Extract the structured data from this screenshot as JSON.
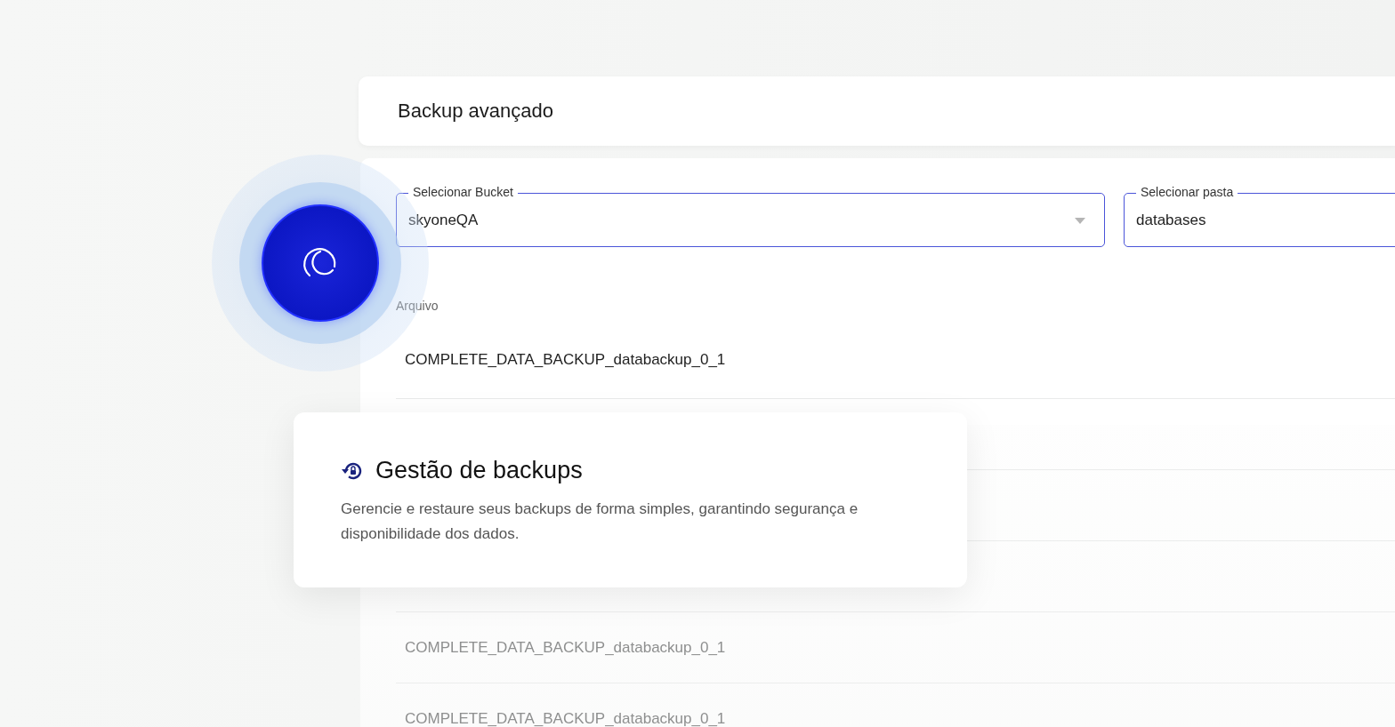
{
  "header": {
    "title": "Backup avançado"
  },
  "fields": [
    {
      "label": "Selecionar Bucket",
      "value": "skyoneQA",
      "kind": "dropdown"
    },
    {
      "label": "Selecionar pasta",
      "value": "databases",
      "kind": "text"
    }
  ],
  "files": {
    "heading": "Arquivo",
    "rows": [
      {
        "file": "COMPLETE_DATA_BACKUP_databackup_0_1",
        "faded": false
      },
      {
        "file": "COMPLETE_DATA_BACKUP_databackup_0_1",
        "faded": true
      },
      {
        "file": "COMPLETE_DATA_BACKUP_databackup_0_1",
        "faded": true
      }
    ]
  },
  "feature_card": {
    "title": "Gestão de backups",
    "description": "Gerencie e restaure seus backups de forma simples, garantindo segurança e disponibilidade dos dados."
  }
}
